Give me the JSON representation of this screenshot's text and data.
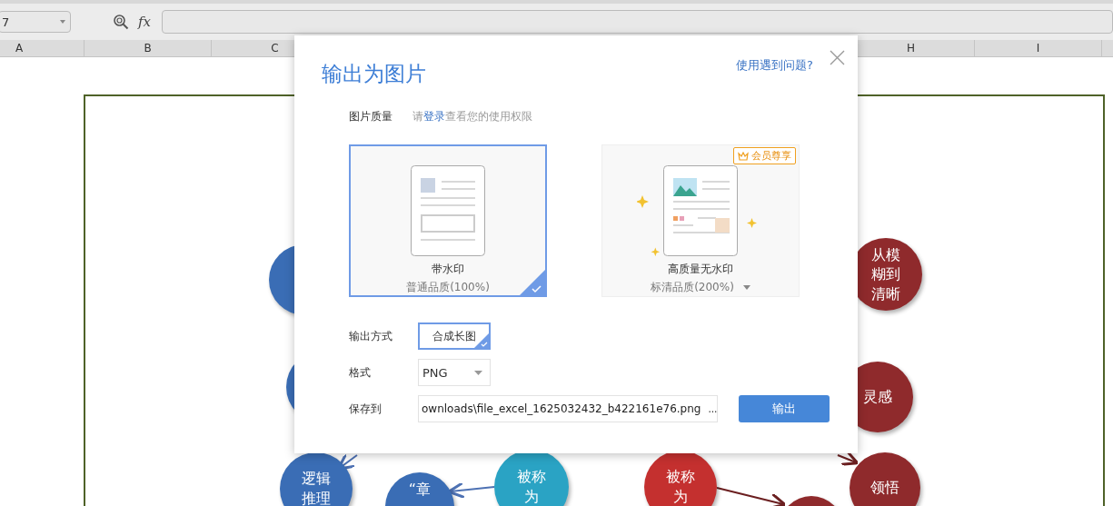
{
  "toolbar": {
    "name_box": "7",
    "formula_label": "fx"
  },
  "columns": [
    {
      "label": "A"
    },
    {
      "label": "B"
    },
    {
      "label": "C"
    },
    {
      "label": "H"
    },
    {
      "label": "I"
    }
  ],
  "diagram": {
    "nodes": [
      {
        "color": "#3a6db5"
      },
      {
        "color": "#3a6db5"
      },
      {
        "label": "逻辑推理",
        "color": "#3a6db5"
      },
      {
        "label": "“章",
        "color": "#3a6db5"
      },
      {
        "label": "被称为",
        "color": "#2aa3c4"
      },
      {
        "label": "被称为",
        "color": "#c4302f"
      },
      {
        "color": "#8f2a2c"
      },
      {
        "label": "从模糊到清晰",
        "color": "#8f2a2c"
      },
      {
        "label": "灵感",
        "color": "#8f2a2c"
      },
      {
        "label": "领悟",
        "color": "#8f2a2c"
      }
    ]
  },
  "dialog": {
    "title": "输出为图片",
    "help_link": "使用遇到问题?",
    "quality": {
      "label": "图片质量",
      "hint_before": "请",
      "login_link": "登录",
      "hint_after": "查看您的使用权限"
    },
    "quality_options": [
      {
        "kind": "watermark",
        "title": "带水印",
        "subtitle": "普通品质(100%)",
        "selected": true
      },
      {
        "kind": "premium",
        "title": "高质量无水印",
        "subtitle": "标清品质(200%)",
        "selected": false,
        "badge": "会员尊享",
        "dropdown": true
      }
    ],
    "output_method": {
      "label": "输出方式",
      "options": [
        {
          "label": "合成长图",
          "selected": true
        }
      ]
    },
    "format": {
      "label": "格式",
      "value": "PNG"
    },
    "save_to": {
      "label": "保存到",
      "path": "ownloads\\file_excel_1625032432_b422161e76.png",
      "browse": "..."
    },
    "export_button": "输出"
  }
}
